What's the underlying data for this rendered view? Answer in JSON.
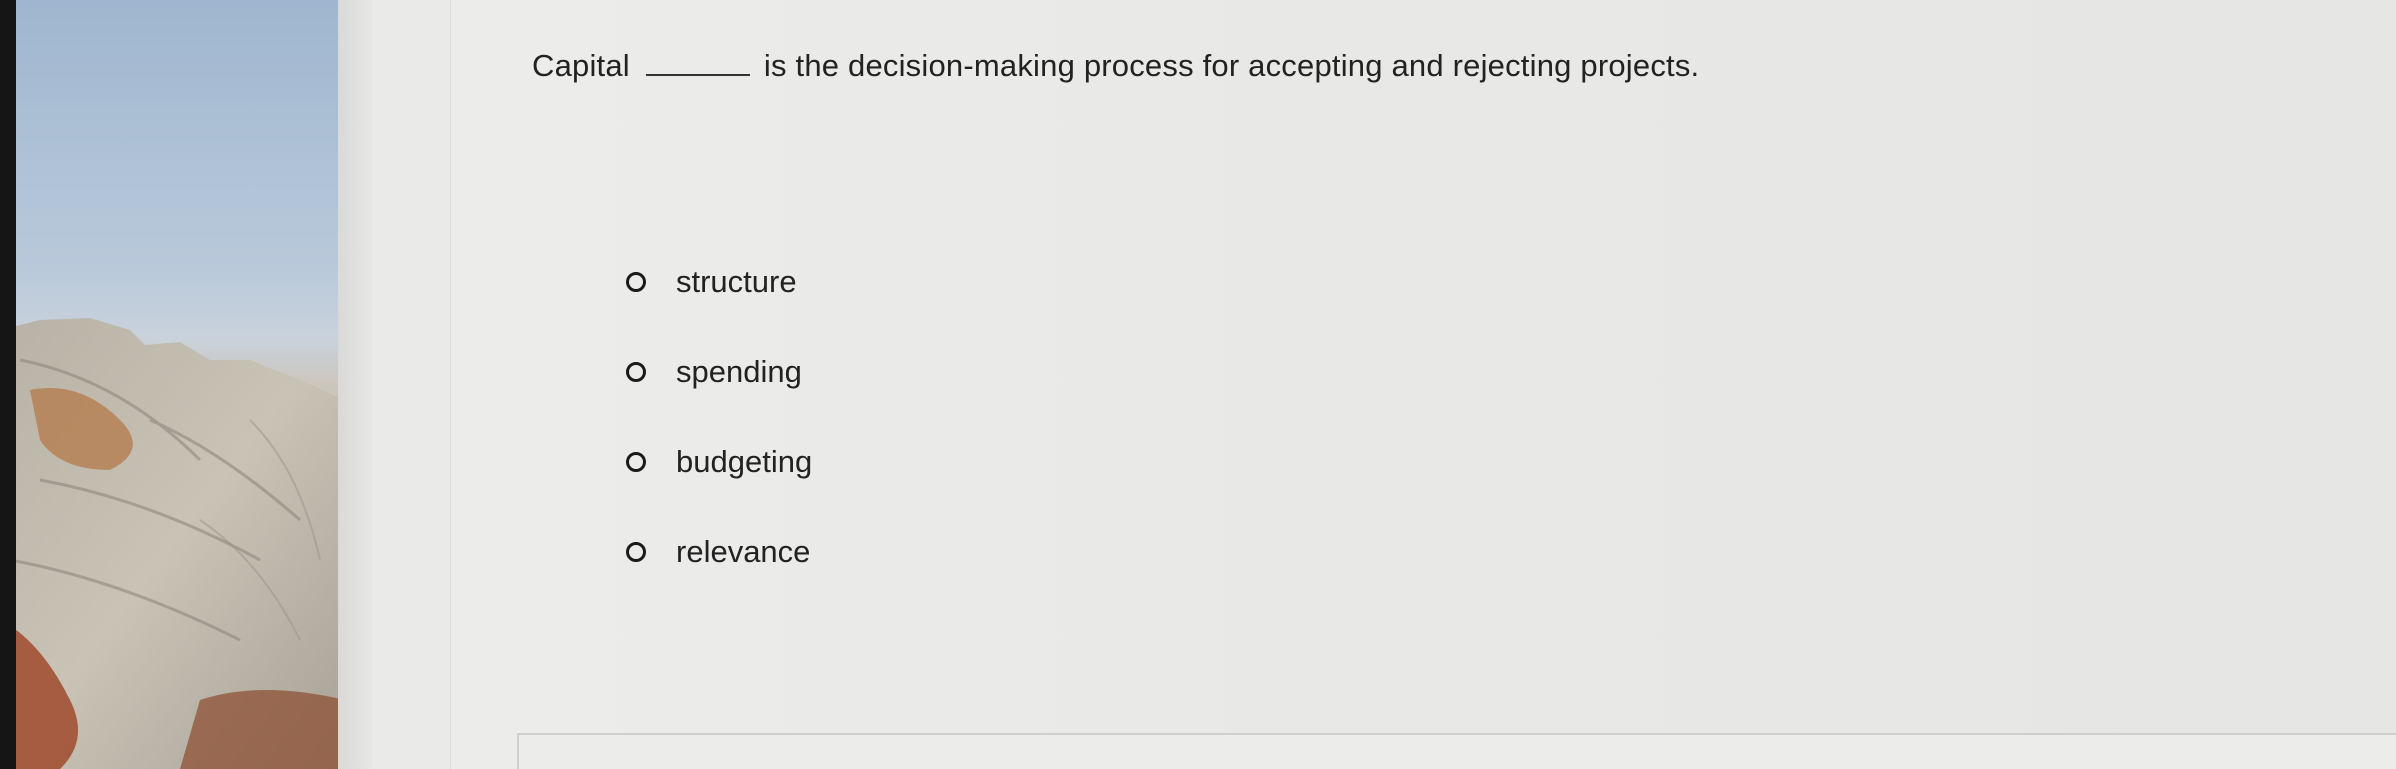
{
  "question": {
    "before_blank": "Capital",
    "after_blank": "is the decision-making process for accepting and rejecting projects."
  },
  "options": [
    {
      "label": "structure"
    },
    {
      "label": "spending"
    },
    {
      "label": "budgeting"
    },
    {
      "label": "relevance"
    }
  ],
  "colors": {
    "text": "#222222",
    "background": "#e9e9e6"
  }
}
